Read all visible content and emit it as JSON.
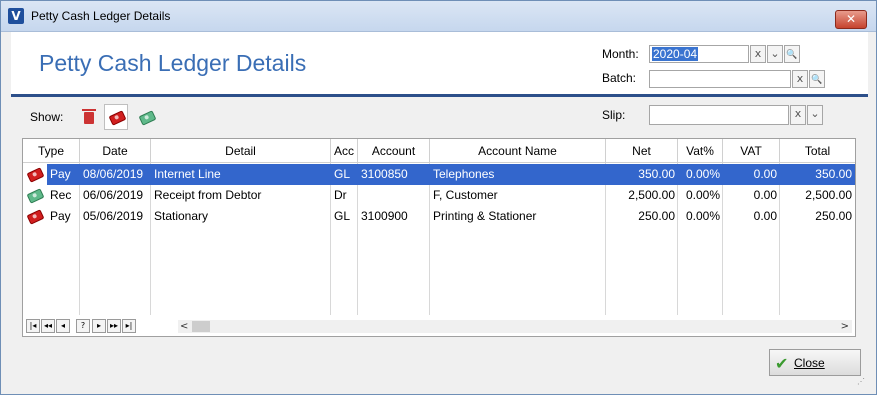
{
  "window": {
    "title": "Petty Cash Ledger Details",
    "close_glyph": "✕"
  },
  "header": {
    "title": "Petty Cash Ledger Details"
  },
  "filters": {
    "month_label": "Month:",
    "month_value": "2020-04",
    "batch_label": "Batch:",
    "batch_value": "",
    "slip_label": "Slip:",
    "slip_value": "",
    "clear_glyph": "x",
    "dropdown_glyph": "⌄",
    "search_glyph": "🔍"
  },
  "show": {
    "label": "Show:",
    "icons": [
      "trash-icon",
      "payment-note-icon",
      "receipt-note-icon"
    ]
  },
  "grid": {
    "columns": [
      "Type",
      "Date",
      "Detail",
      "Acc",
      "Account",
      "Account Name",
      "Net",
      "Vat%",
      "VAT",
      "Total"
    ],
    "rows": [
      {
        "type": "Pay",
        "date": "08/06/2019",
        "detail": "Internet Line",
        "acc": "GL",
        "account": "3100850",
        "account_name": "Telephones",
        "net": "350.00",
        "vat_pct": "0.00%",
        "vat": "0.00",
        "total": "350.00",
        "selected": true,
        "icon": "red-note-icon"
      },
      {
        "type": "Rec",
        "date": "06/06/2019",
        "detail": "Receipt from Debtor",
        "acc": "Dr",
        "account": "",
        "account_name": "F, Customer",
        "net": "2,500.00",
        "vat_pct": "0.00%",
        "vat": "0.00",
        "total": "2,500.00",
        "selected": false,
        "icon": "green-note-icon"
      },
      {
        "type": "Pay",
        "date": "05/06/2019",
        "detail": "Stationary",
        "acc": "GL",
        "account": "3100900",
        "account_name": "Printing & Stationer",
        "net": "250.00",
        "vat_pct": "0.00%",
        "vat": "0.00",
        "total": "250.00",
        "selected": false,
        "icon": "red-note-icon"
      }
    ],
    "navigator": [
      "|◂",
      "◂◂",
      "◂",
      "?",
      "▸",
      "▸▸",
      "▸|"
    ],
    "scroll_left": "<",
    "scroll_right": ">"
  },
  "footer": {
    "close_label": "Close",
    "close_icon": "check-icon"
  },
  "colors": {
    "selection": "#3366cc",
    "title_blue": "#3a6eb5",
    "rule": "#2c4f8a"
  }
}
